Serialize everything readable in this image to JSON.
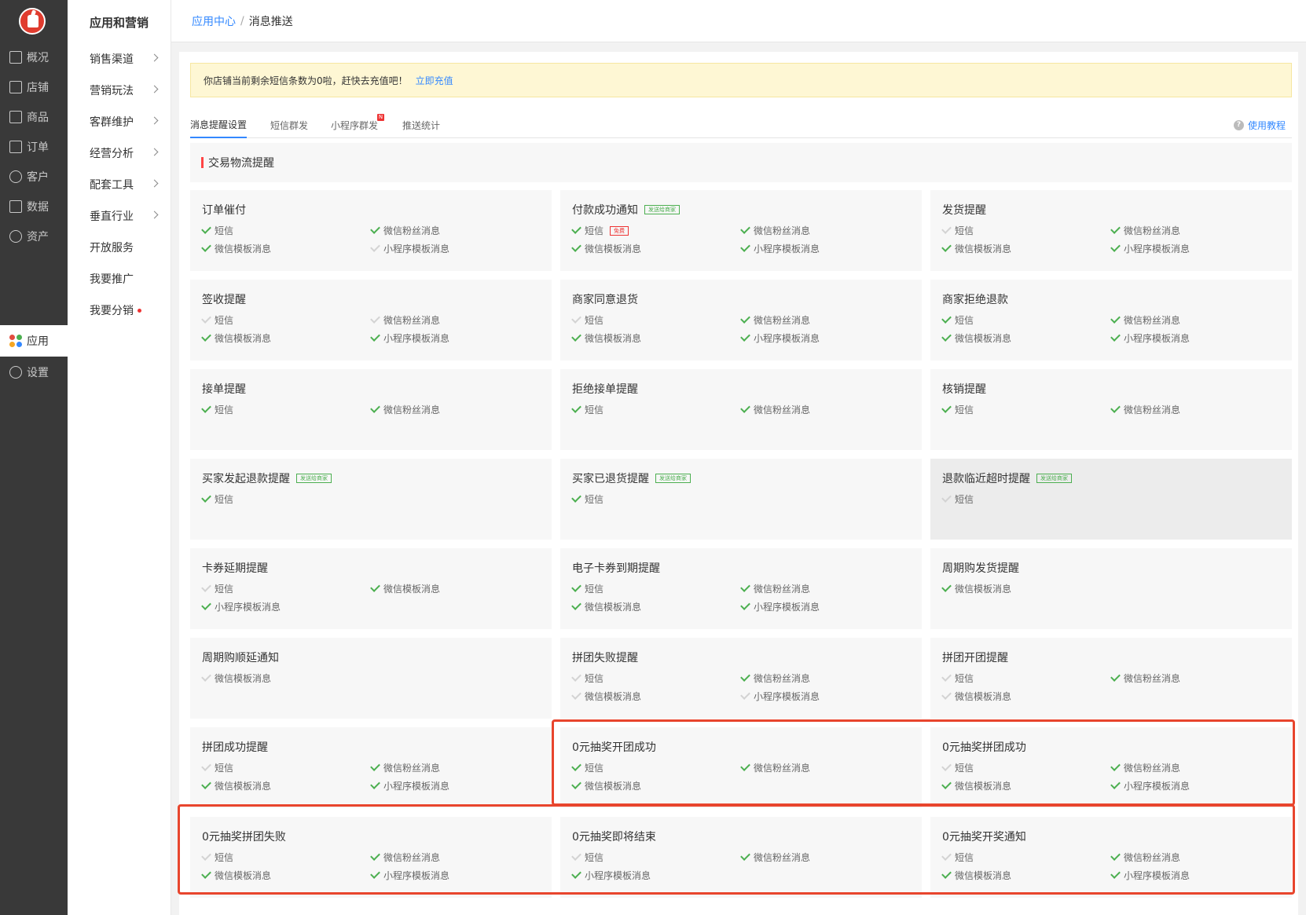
{
  "nav": {
    "items": [
      {
        "label": "概况",
        "icon": "monitor-icon"
      },
      {
        "label": "店铺",
        "icon": "store-icon"
      },
      {
        "label": "商品",
        "icon": "tag-icon"
      },
      {
        "label": "订单",
        "icon": "document-icon"
      },
      {
        "label": "客户",
        "icon": "user-icon"
      },
      {
        "label": "数据",
        "icon": "bar-chart-icon"
      },
      {
        "label": "资产",
        "icon": "yen-icon"
      },
      {
        "label": "应用",
        "icon": "apps-icon",
        "active": true
      },
      {
        "label": "设置",
        "icon": "gear-icon"
      }
    ]
  },
  "submenu": {
    "title": "应用和营销",
    "items": [
      {
        "label": "销售渠道",
        "chevron": true
      },
      {
        "label": "营销玩法",
        "chevron": true
      },
      {
        "label": "客群维护",
        "chevron": true
      },
      {
        "label": "经营分析",
        "chevron": true
      },
      {
        "label": "配套工具",
        "chevron": true
      },
      {
        "label": "垂直行业",
        "chevron": true
      },
      {
        "label": "开放服务",
        "chevron": false
      },
      {
        "label": "我要推广",
        "chevron": false
      },
      {
        "label": "我要分销",
        "chevron": false,
        "dot": true
      }
    ]
  },
  "breadcrumb": {
    "root": "应用中心",
    "separator": "/",
    "current": "消息推送"
  },
  "alert": {
    "text": "你店铺当前剩余短信条数为0啦，赶快去充值吧！",
    "link": "立即充值"
  },
  "tabs": [
    {
      "label": "消息提醒设置",
      "active": true
    },
    {
      "label": "短信群发"
    },
    {
      "label": "小程序群发",
      "badge": "N"
    },
    {
      "label": "推送统计"
    }
  ],
  "help": {
    "icon": "?",
    "label": "使用教程"
  },
  "section": {
    "title": "交易物流提醒"
  },
  "colors": {
    "accent": "#3388ff",
    "check_on": "#4caf50",
    "check_off": "#d3d3d3",
    "highlight": "#e8452d",
    "nav_bg": "#393939"
  },
  "cards": [
    {
      "title": "订单催付",
      "channels": [
        {
          "label": "短信",
          "on": true
        },
        {
          "label": "微信粉丝消息",
          "on": true
        },
        {
          "label": "微信模板消息",
          "on": true
        },
        {
          "label": "小程序模板消息",
          "on": false
        }
      ]
    },
    {
      "title": "付款成功通知",
      "tag": "发送给商家",
      "channels": [
        {
          "label": "短信",
          "on": true,
          "tag": "免费"
        },
        {
          "label": "微信粉丝消息",
          "on": true
        },
        {
          "label": "微信模板消息",
          "on": true
        },
        {
          "label": "小程序模板消息",
          "on": true
        }
      ]
    },
    {
      "title": "发货提醒",
      "channels": [
        {
          "label": "短信",
          "on": false
        },
        {
          "label": "微信粉丝消息",
          "on": true
        },
        {
          "label": "微信模板消息",
          "on": true
        },
        {
          "label": "小程序模板消息",
          "on": true
        }
      ]
    },
    {
      "title": "签收提醒",
      "channels": [
        {
          "label": "短信",
          "on": false
        },
        {
          "label": "微信粉丝消息",
          "on": false
        },
        {
          "label": "微信模板消息",
          "on": true
        },
        {
          "label": "小程序模板消息",
          "on": true
        }
      ]
    },
    {
      "title": "商家同意退货",
      "channels": [
        {
          "label": "短信",
          "on": false
        },
        {
          "label": "微信粉丝消息",
          "on": true
        },
        {
          "label": "微信模板消息",
          "on": true
        },
        {
          "label": "小程序模板消息",
          "on": true
        }
      ]
    },
    {
      "title": "商家拒绝退款",
      "channels": [
        {
          "label": "短信",
          "on": true
        },
        {
          "label": "微信粉丝消息",
          "on": true
        },
        {
          "label": "微信模板消息",
          "on": true
        },
        {
          "label": "小程序模板消息",
          "on": true
        }
      ]
    },
    {
      "title": "接单提醒",
      "channels": [
        {
          "label": "短信",
          "on": true
        },
        {
          "label": "微信粉丝消息",
          "on": true
        }
      ]
    },
    {
      "title": "拒绝接单提醒",
      "channels": [
        {
          "label": "短信",
          "on": true
        },
        {
          "label": "微信粉丝消息",
          "on": true
        }
      ]
    },
    {
      "title": "核销提醒",
      "channels": [
        {
          "label": "短信",
          "on": true
        },
        {
          "label": "微信粉丝消息",
          "on": true
        }
      ]
    },
    {
      "title": "买家发起退款提醒",
      "tag": "发送给商家",
      "channels": [
        {
          "label": "短信",
          "on": true
        }
      ]
    },
    {
      "title": "买家已退货提醒",
      "tag": "发送给商家",
      "channels": [
        {
          "label": "短信",
          "on": true
        }
      ]
    },
    {
      "title": "退款临近超时提醒",
      "tag": "发送给商家",
      "dim": true,
      "channels": [
        {
          "label": "短信",
          "on": false
        }
      ]
    },
    {
      "title": "卡券延期提醒",
      "channels": [
        {
          "label": "短信",
          "on": false
        },
        {
          "label": "微信模板消息",
          "on": true
        },
        {
          "label": "小程序模板消息",
          "on": true
        }
      ]
    },
    {
      "title": "电子卡券到期提醒",
      "channels": [
        {
          "label": "短信",
          "on": true
        },
        {
          "label": "微信粉丝消息",
          "on": true
        },
        {
          "label": "微信模板消息",
          "on": true
        },
        {
          "label": "小程序模板消息",
          "on": true
        }
      ]
    },
    {
      "title": "周期购发货提醒",
      "channels": [
        {
          "label": "微信模板消息",
          "on": true
        }
      ]
    },
    {
      "title": "周期购顺延通知",
      "channels": [
        {
          "label": "微信模板消息",
          "on": false
        }
      ]
    },
    {
      "title": "拼团失败提醒",
      "channels": [
        {
          "label": "短信",
          "on": false
        },
        {
          "label": "微信粉丝消息",
          "on": true
        },
        {
          "label": "微信模板消息",
          "on": false
        },
        {
          "label": "小程序模板消息",
          "on": false
        }
      ]
    },
    {
      "title": "拼团开团提醒",
      "channels": [
        {
          "label": "短信",
          "on": false
        },
        {
          "label": "微信粉丝消息",
          "on": true
        },
        {
          "label": "微信模板消息",
          "on": false
        }
      ]
    },
    {
      "title": "拼团成功提醒",
      "channels": [
        {
          "label": "短信",
          "on": false
        },
        {
          "label": "微信粉丝消息",
          "on": true
        },
        {
          "label": "微信模板消息",
          "on": true
        },
        {
          "label": "小程序模板消息",
          "on": true
        }
      ]
    },
    {
      "title": "0元抽奖开团成功",
      "channels": [
        {
          "label": "短信",
          "on": true
        },
        {
          "label": "微信粉丝消息",
          "on": true
        },
        {
          "label": "微信模板消息",
          "on": true
        }
      ]
    },
    {
      "title": "0元抽奖拼团成功",
      "channels": [
        {
          "label": "短信",
          "on": false
        },
        {
          "label": "微信粉丝消息",
          "on": true
        },
        {
          "label": "微信模板消息",
          "on": true
        },
        {
          "label": "小程序模板消息",
          "on": true
        }
      ]
    },
    {
      "title": "0元抽奖拼团失败",
      "channels": [
        {
          "label": "短信",
          "on": false
        },
        {
          "label": "微信粉丝消息",
          "on": true
        },
        {
          "label": "微信模板消息",
          "on": true
        },
        {
          "label": "小程序模板消息",
          "on": true
        }
      ]
    },
    {
      "title": "0元抽奖即将结束",
      "channels": [
        {
          "label": "短信",
          "on": false
        },
        {
          "label": "微信粉丝消息",
          "on": true
        },
        {
          "label": "小程序模板消息",
          "on": true
        }
      ]
    },
    {
      "title": "0元抽奖开奖通知",
      "channels": [
        {
          "label": "短信",
          "on": false
        },
        {
          "label": "微信粉丝消息",
          "on": true
        },
        {
          "label": "微信模板消息",
          "on": true
        },
        {
          "label": "小程序模板消息",
          "on": true
        }
      ]
    }
  ]
}
